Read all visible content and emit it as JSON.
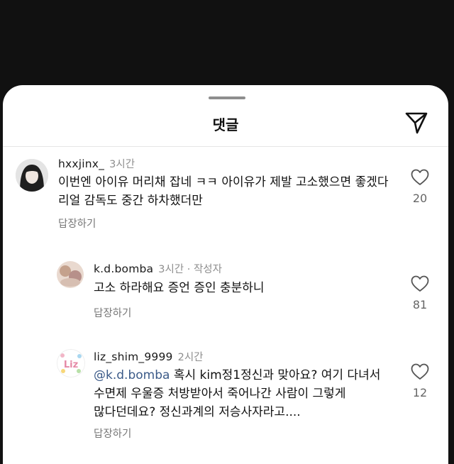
{
  "sheet": {
    "title": "댓글",
    "send_icon": "send-icon"
  },
  "comments": [
    {
      "username": "hxxjinx_",
      "time": "3시간",
      "text": "이번엔 아이유 머리채 잡네 ㅋㅋ 아이유가 제발 고소했으면 좋겠다 리얼 감독도 중간 하차했더만",
      "likes": "20",
      "reply_label": "답장하기"
    },
    {
      "username": "k.d.bomba",
      "time": "3시간 · 작성자",
      "text": "고소 하라해요 증언 증인 충분하니",
      "likes": "81",
      "reply_label": "답장하기"
    },
    {
      "username": "liz_shim_9999",
      "time": "2시간",
      "mention": "@k.d.bomba",
      "text": "혹시 kim정1정신과 맞아요? 여기 다녀서 수면제 우울증 처방받아서 죽어나간 사람이 그렇게 많다던데요? 정신과계의 저승사자라고....",
      "likes": "12",
      "reply_label": "답장하기"
    }
  ],
  "colors": {
    "mention": "#3b5a88",
    "meta": "#8e8e8e",
    "backdrop": "#111111"
  }
}
